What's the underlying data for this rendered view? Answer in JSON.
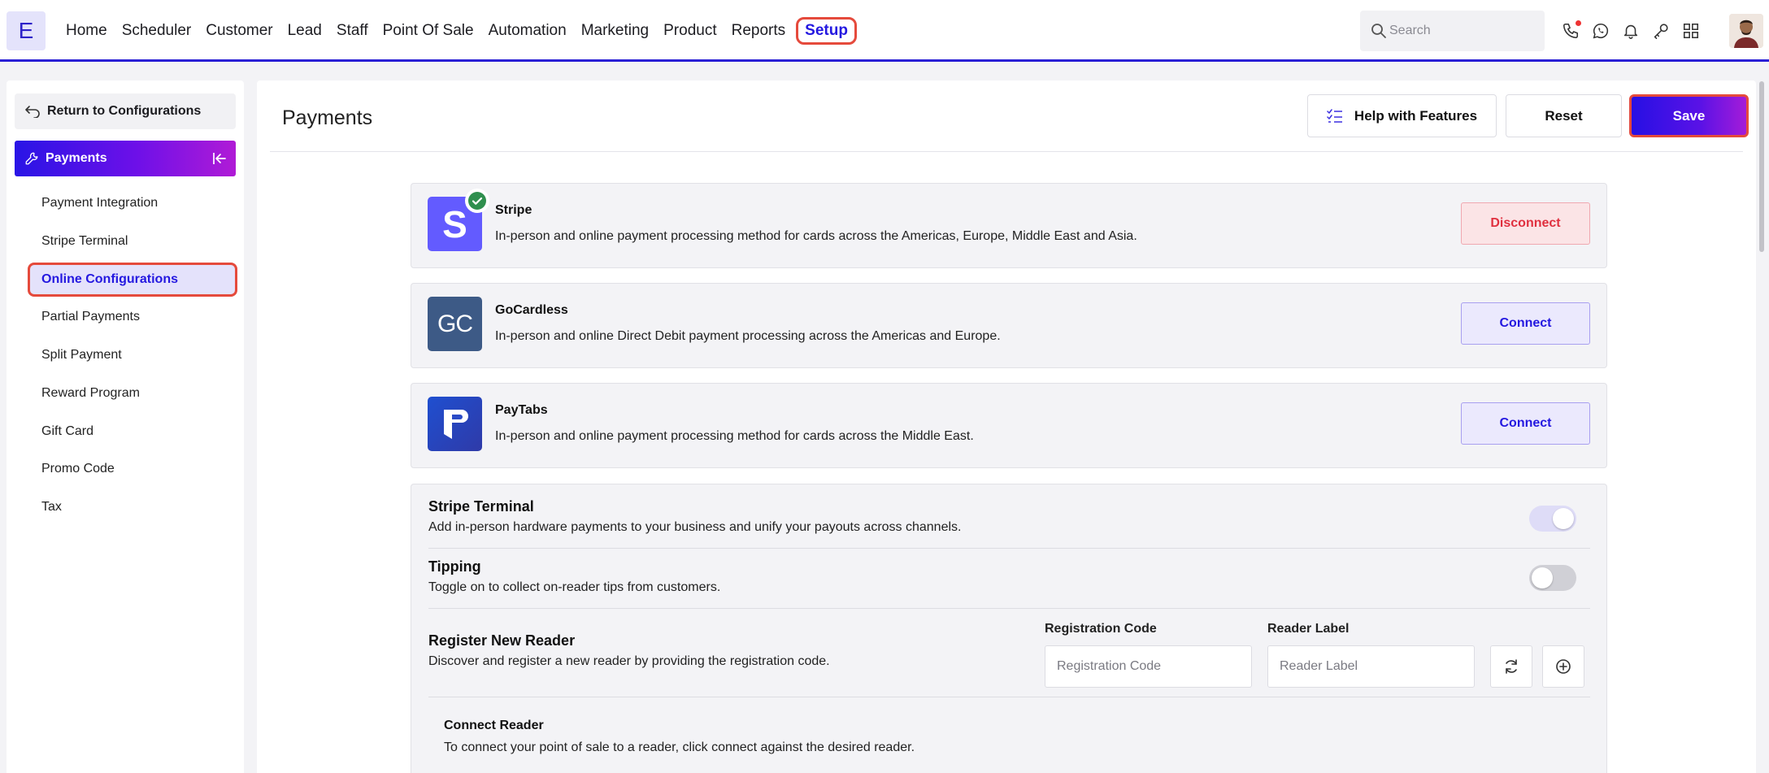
{
  "app": {
    "logo_letter": "E"
  },
  "nav": {
    "items": [
      "Home",
      "Scheduler",
      "Customer",
      "Lead",
      "Staff",
      "Point Of Sale",
      "Automation",
      "Marketing",
      "Product",
      "Reports"
    ],
    "active": "Setup"
  },
  "search": {
    "placeholder": "Search"
  },
  "top_icons": [
    "phone-icon",
    "whatsapp-icon",
    "bell-icon",
    "key-icon",
    "apps-grid-icon"
  ],
  "sidebar": {
    "return_label": "Return to Configurations",
    "section_label": "Payments",
    "items": [
      "Payment Integration",
      "Stripe Terminal",
      "Online Configurations",
      "Partial Payments",
      "Split Payment",
      "Reward Program",
      "Gift Card",
      "Promo Code",
      "Tax"
    ],
    "active_item": "Online Configurations"
  },
  "header": {
    "title": "Payments",
    "help_label": "Help with Features",
    "reset_label": "Reset",
    "save_label": "Save"
  },
  "providers": [
    {
      "name": "Stripe",
      "description": "In-person and online payment processing method for cards across the Americas, Europe, Middle East and Asia.",
      "action": "Disconnect",
      "connected": true,
      "logo_text": "S",
      "color": "#635bff"
    },
    {
      "name": "GoCardless",
      "description": "In-person and online Direct Debit payment processing across the Americas and Europe.",
      "action": "Connect",
      "connected": false,
      "logo_text": "GC",
      "color": "#3d5a86"
    },
    {
      "name": "PayTabs",
      "description": "In-person and online payment processing method for cards across the Middle East.",
      "action": "Connect",
      "connected": false,
      "logo_text": "P",
      "color": "#2a4bc7"
    }
  ],
  "terminal": {
    "title": "Stripe Terminal",
    "description": "Add in-person hardware payments to your business and unify your payouts across channels.",
    "enabled": true,
    "tipping": {
      "title": "Tipping",
      "description": "Toggle on to collect on-reader tips from customers.",
      "enabled": false
    },
    "register": {
      "title": "Register New Reader",
      "description": "Discover and register a new reader by providing the registration code.",
      "code_label": "Registration Code",
      "code_placeholder": "Registration Code",
      "reader_label": "Reader Label",
      "reader_placeholder": "Reader Label"
    },
    "connect": {
      "title": "Connect Reader",
      "description": "To connect your point of sale to a reader, click connect against the desired reader."
    }
  },
  "colors": {
    "accent": "#2418e0",
    "highlight": "#e54a3c",
    "danger": "#e0303f"
  }
}
